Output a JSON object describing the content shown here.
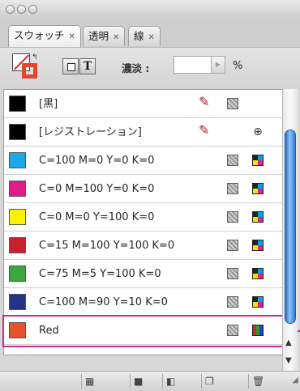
{
  "tabs": [
    {
      "label": "スウォッチ"
    },
    {
      "label": "透明"
    },
    {
      "label": "線"
    }
  ],
  "toolbar": {
    "tint_label": "濃淡 :",
    "tint_value": "",
    "tint_unit": "%",
    "text_button_label": "T"
  },
  "swatches": [
    {
      "name": "[黒]",
      "color": "#000000",
      "icons": [
        "pencil-icon",
        "process-color-icon"
      ]
    },
    {
      "name": "[レジストレーション]",
      "color": "#000000",
      "icons": [
        "pencil-icon",
        "registration-icon"
      ]
    },
    {
      "name": "C=100 M=0 Y=0 K=0",
      "color": "#1aa9e6",
      "icons": [
        "process-color-icon",
        "cmyk-icon"
      ]
    },
    {
      "name": "C=0 M=100 Y=0 K=0",
      "color": "#e21b8c",
      "icons": [
        "process-color-icon",
        "cmyk-icon"
      ]
    },
    {
      "name": "C=0 M=0 Y=100 K=0",
      "color": "#fff200",
      "icons": [
        "process-color-icon",
        "cmyk-icon"
      ]
    },
    {
      "name": "C=15 M=100 Y=100 K=0",
      "color": "#c8202c",
      "icons": [
        "process-color-icon",
        "cmyk-icon"
      ]
    },
    {
      "name": "C=75 M=5 Y=100 K=0",
      "color": "#3aa93c",
      "icons": [
        "process-color-icon",
        "cmyk-icon"
      ]
    },
    {
      "name": "C=100 M=90 Y=10 K=0",
      "color": "#22338a",
      "icons": [
        "process-color-icon",
        "cmyk-icon"
      ]
    },
    {
      "name": "Red",
      "color": "#e6532a",
      "icons": [
        "process-color-icon",
        "rgb-icon"
      ]
    }
  ],
  "colors": {
    "selection_outline": "#d2288c",
    "scroll_thumb": "#3b84d8"
  }
}
